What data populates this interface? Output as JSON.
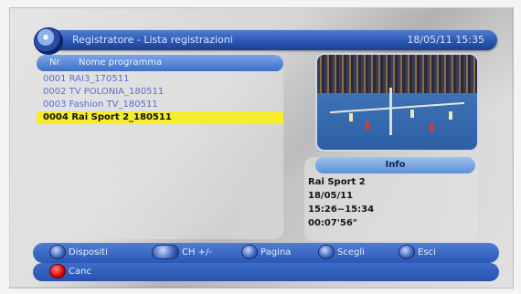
{
  "header": {
    "title": "Registratore - Lista registrazioni",
    "datetime": "18/05/11 15:35"
  },
  "list": {
    "col_nr": "Nr",
    "col_name": "Nome programma",
    "items": [
      {
        "text": "0001 RAI3_170511",
        "selected": false
      },
      {
        "text": "0002 TV POLONIA_180511",
        "selected": false
      },
      {
        "text": "0003 Fashion TV_180511",
        "selected": false
      },
      {
        "text": "0004 Rai Sport 2_180511",
        "selected": true
      }
    ]
  },
  "info": {
    "title": "Info",
    "lines": [
      "Rai Sport 2",
      "18/05/11",
      "15:26~15:34",
      "00:07'56\""
    ]
  },
  "footer": {
    "dispositivi": "Dispositi",
    "ch": "CH +/-",
    "pagina": "Pagina",
    "scegli": "Scegli",
    "esci": "Esci",
    "canc": "Canc"
  }
}
